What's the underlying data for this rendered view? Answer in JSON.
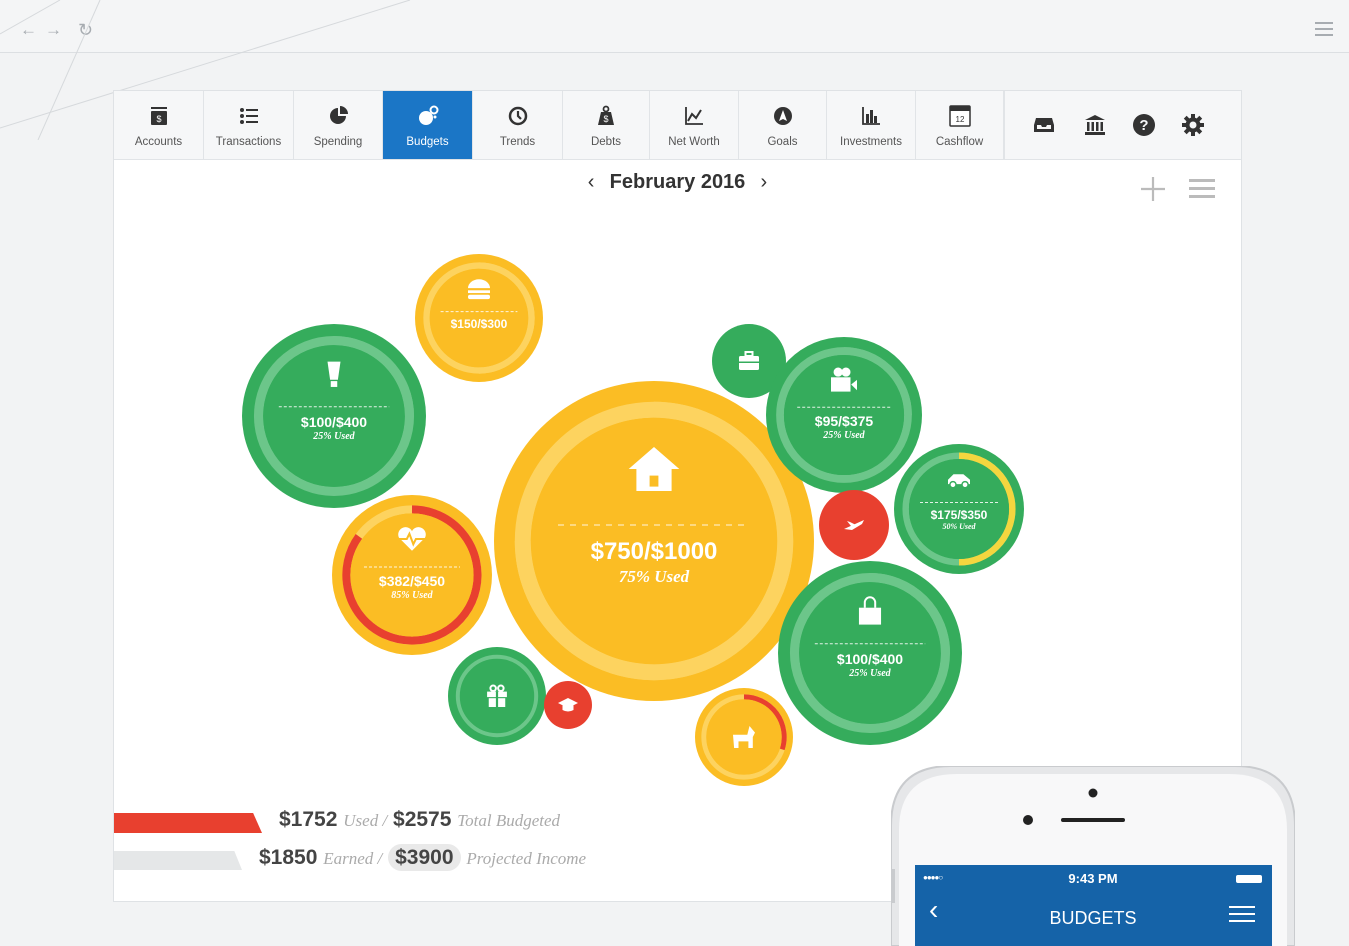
{
  "browser": {
    "back_icon": "arrow-left-icon",
    "forward_icon": "arrow-right-icon",
    "reload_icon": "reload-icon",
    "menu_icon": "hamburger-icon"
  },
  "tabs": [
    {
      "label": "Accounts",
      "icon": "accounts-icon",
      "active": false
    },
    {
      "label": "Transactions",
      "icon": "list-icon",
      "active": false
    },
    {
      "label": "Spending",
      "icon": "pie-icon",
      "active": false
    },
    {
      "label": "Budgets",
      "icon": "bubbles-icon",
      "active": true
    },
    {
      "label": "Trends",
      "icon": "clock-icon",
      "active": false
    },
    {
      "label": "Debts",
      "icon": "weight-icon",
      "active": false
    },
    {
      "label": "Net Worth",
      "icon": "line-chart-icon",
      "active": false
    },
    {
      "label": "Goals",
      "icon": "compass-icon",
      "active": false
    },
    {
      "label": "Investments",
      "icon": "bar-chart-icon",
      "active": false
    },
    {
      "label": "Cashflow",
      "icon": "calendar-icon",
      "active": false,
      "calendar_day": "12"
    }
  ],
  "tools": [
    "inbox-icon",
    "bank-icon",
    "help-icon",
    "gear-icon"
  ],
  "period": {
    "prev": "‹",
    "label": "February 2016",
    "next": "›"
  },
  "colors": {
    "green": "#35ac5c",
    "yellow": "#fbbd24",
    "red": "#e8402f",
    "blue": "#1b76c6"
  },
  "bubbles": [
    {
      "name": "home",
      "icon": "home-icon",
      "amount": "$750/$1000",
      "used": "75% Used",
      "color": "yellow",
      "progress": 0.75
    },
    {
      "name": "utilities",
      "icon": "bulb-icon",
      "amount": "$100/$400",
      "used": "25% Used",
      "color": "green",
      "progress": 0.25
    },
    {
      "name": "food",
      "icon": "burger-icon",
      "amount": "$150/$300",
      "used": "",
      "color": "yellow",
      "progress": 0.5
    },
    {
      "name": "work",
      "icon": "briefcase-icon",
      "amount": "",
      "used": "",
      "color": "green",
      "progress": 0
    },
    {
      "name": "entertainment",
      "icon": "camera-icon",
      "amount": "$95/$375",
      "used": "25% Used",
      "color": "green",
      "progress": 0.25
    },
    {
      "name": "auto",
      "icon": "car-icon",
      "amount": "$175/$350",
      "used": "50% Used",
      "color": "green",
      "progress": 0.5
    },
    {
      "name": "travel",
      "icon": "plane-icon",
      "amount": "",
      "used": "",
      "color": "red",
      "progress": 0
    },
    {
      "name": "health",
      "icon": "heart-icon",
      "amount": "$382/$450",
      "used": "85% Used",
      "color": "yellow",
      "progress": 0.85
    },
    {
      "name": "shopping",
      "icon": "bag-icon",
      "amount": "$100/$400",
      "used": "25% Used",
      "color": "green",
      "progress": 0.25
    },
    {
      "name": "gifts",
      "icon": "gift-icon",
      "amount": "",
      "used": "",
      "color": "green",
      "progress": 0
    },
    {
      "name": "education",
      "icon": "cap-icon",
      "amount": "",
      "used": "",
      "color": "red",
      "progress": 0
    },
    {
      "name": "pets",
      "icon": "dog-icon",
      "amount": "",
      "used": "",
      "color": "yellow",
      "progress": 0.3
    }
  ],
  "summary": {
    "used_amount": "$1752",
    "used_label": "Used /",
    "total_amount": "$2575",
    "total_label": "Total Budgeted",
    "earned_amount": "$1850",
    "earned_label": "Earned /",
    "projected_amount": "$3900",
    "projected_label": "Projected Income",
    "used_fraction": 0.68,
    "earned_fraction": 0.47
  },
  "phone": {
    "signal": "●●●●○",
    "time": "9:43 PM",
    "title": "BUDGETS",
    "back": "‹"
  }
}
